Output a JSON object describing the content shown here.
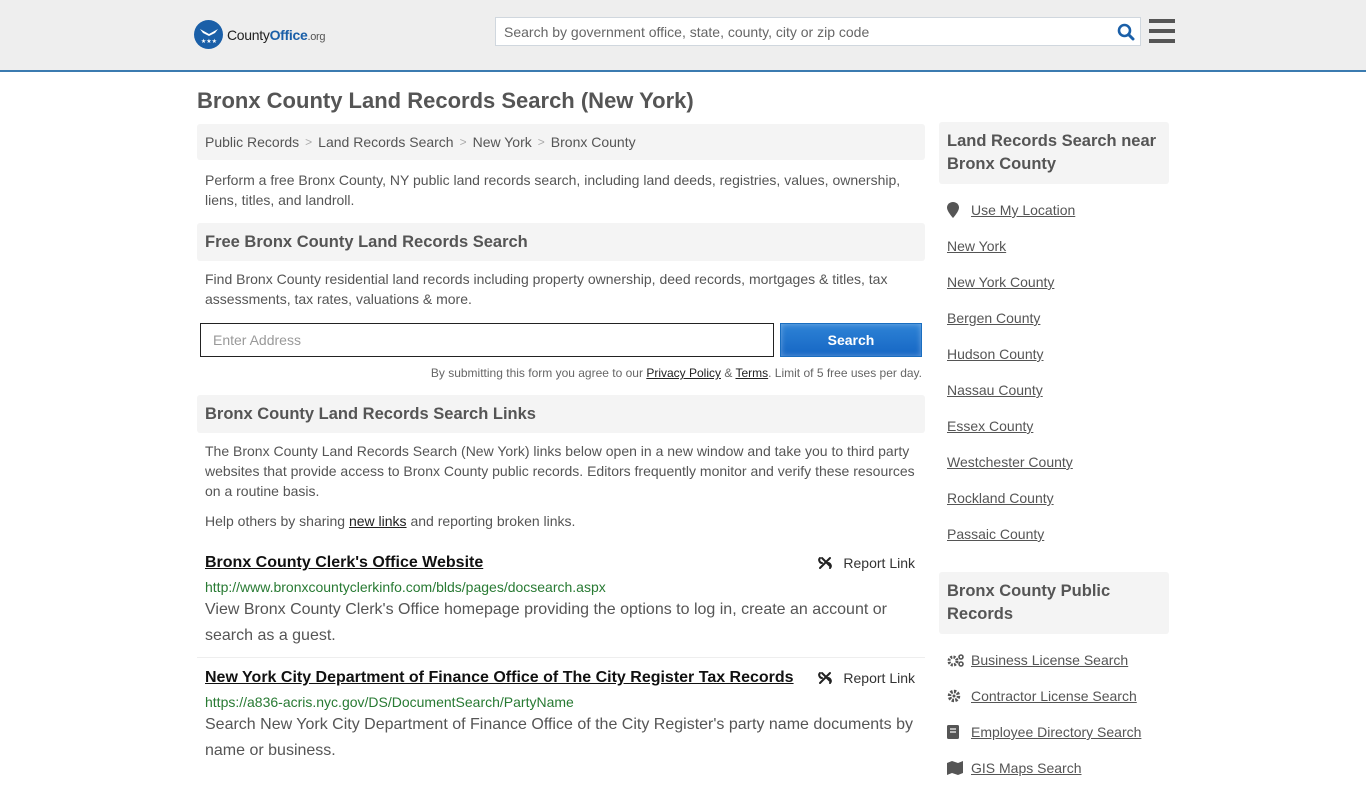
{
  "header": {
    "logo": {
      "county": "County",
      "office": "Office",
      "org": ".org"
    },
    "search_placeholder": "Search by government office, state, county, city or zip code"
  },
  "page_title": "Bronx County Land Records Search (New York)",
  "breadcrumb": [
    "Public Records",
    "Land Records Search",
    "New York",
    "Bronx County"
  ],
  "intro": "Perform a free Bronx County, NY public land records search, including land deeds, registries, values, ownership, liens, titles, and landroll.",
  "free_search": {
    "heading": "Free Bronx County Land Records Search",
    "description": "Find Bronx County residential land records including property ownership, deed records, mortgages & titles, tax assessments, tax rates, valuations & more.",
    "address_placeholder": "Enter Address",
    "button_label": "Search",
    "terms_prefix": "By submitting this form you agree to our ",
    "privacy_label": "Privacy Policy",
    "amp": " & ",
    "terms_label": "Terms",
    "terms_suffix": ". Limit of 5 free uses per day."
  },
  "links_section": {
    "heading": "Bronx County Land Records Search Links",
    "description": "The Bronx County Land Records Search (New York) links below open in a new window and take you to third party websites that provide access to Bronx County public records. Editors frequently monitor and verify these resources on a routine basis.",
    "help_prefix": "Help others by sharing ",
    "help_link": "new links",
    "help_suffix": " and reporting broken links.",
    "report_label": "Report Link",
    "items": [
      {
        "title": "Bronx County Clerk's Office Website",
        "url": "http://www.bronxcountyclerkinfo.com/blds/pages/docsearch.aspx",
        "description": "View Bronx County Clerk's Office homepage providing the options to log in, create an account or search as a guest."
      },
      {
        "title": "New York City Department of Finance Office of The City Register Tax Records",
        "url": "https://a836-acris.nyc.gov/DS/DocumentSearch/PartyName",
        "description": "Search New York City Department of Finance Office of the City Register's party name documents by name or business."
      }
    ]
  },
  "sidebar": {
    "nearby_heading": "Land Records Search near Bronx County",
    "use_location": "Use My Location",
    "nearby": [
      "New York",
      "New York County",
      "Bergen County",
      "Hudson County",
      "Nassau County",
      "Essex County",
      "Westchester County",
      "Rockland County",
      "Passaic County"
    ],
    "public_heading": "Bronx County Public Records",
    "public_records": [
      {
        "label": "Business License Search",
        "icon": "gears-icon"
      },
      {
        "label": "Contractor License Search",
        "icon": "gear-icon"
      },
      {
        "label": "Employee Directory Search",
        "icon": "book-icon"
      },
      {
        "label": "GIS Maps Search",
        "icon": "map-icon"
      }
    ]
  },
  "colors": {
    "brand": "#1a5fa8",
    "header_border": "#3b7bb0",
    "url_green": "#287a33"
  }
}
